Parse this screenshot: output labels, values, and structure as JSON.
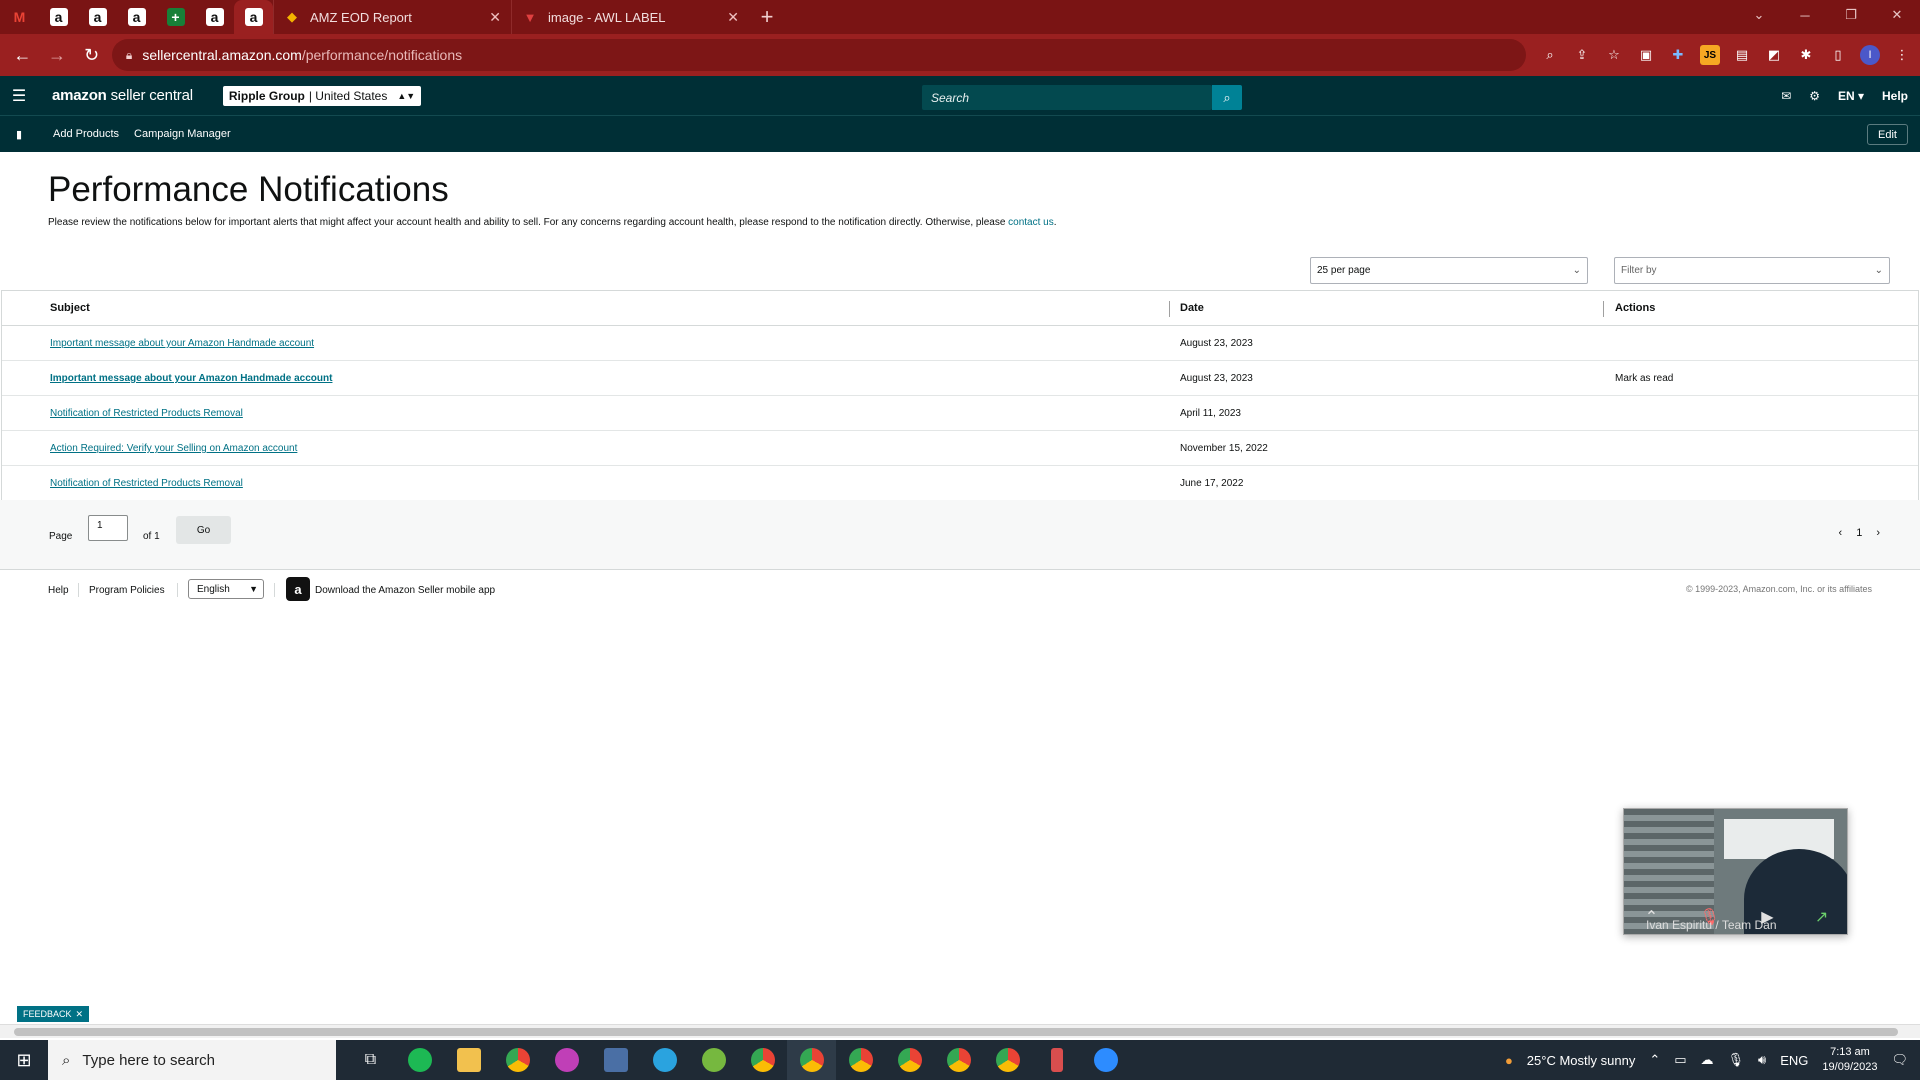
{
  "browser": {
    "tabs": [
      {
        "title": "AMZ EOD Report",
        "icon": "google-sheets-like-icon"
      },
      {
        "title": "image - AWL LABEL",
        "icon": "image-icon"
      }
    ],
    "url_host": "sellercentral.amazon.com",
    "url_path": "/performance/notifications"
  },
  "header": {
    "logo_bold": "amazon",
    "logo_rest": " seller central",
    "account_bold": "Ripple Group",
    "account_rest": " | United States",
    "search_placeholder": "Search",
    "lang": "EN",
    "help": "Help"
  },
  "bookmarks": {
    "items": [
      "Add Products",
      "Campaign Manager"
    ],
    "edit": "Edit"
  },
  "page": {
    "title": "Performance Notifications",
    "description": "Please review the notifications below for important alerts that might affect your account health and ability to sell. For any concerns regarding account health, please respond to the notification directly. Otherwise, please ",
    "contact_link": "contact us",
    "per_page": "25 per page",
    "filter_placeholder": "Filter by"
  },
  "table": {
    "headers": [
      "Subject",
      "Date",
      "Actions"
    ],
    "rows": [
      {
        "subject": "Important message about your Amazon Handmade account",
        "date": "August 23, 2023",
        "action": "",
        "unread": false
      },
      {
        "subject": "Important message about your Amazon Handmade account",
        "date": "August 23, 2023",
        "action": "Mark as read",
        "unread": true
      },
      {
        "subject": "Notification of Restricted Products Removal",
        "date": "April 11, 2023",
        "action": "",
        "unread": false
      },
      {
        "subject": "Action Required: Verify your Selling on Amazon account",
        "date": "November 15, 2022",
        "action": "",
        "unread": false
      },
      {
        "subject": "Notification of Restricted Products Removal",
        "date": "June 17, 2022",
        "action": "",
        "unread": false
      }
    ]
  },
  "pager": {
    "page_label": "Page",
    "page_value": "1",
    "of_label": "of 1",
    "go": "Go",
    "current": "1"
  },
  "footer": {
    "help": "Help",
    "policies": "Program Policies",
    "language": "English",
    "app_text": "Download the Amazon Seller mobile app",
    "copyright": "© 1999-2023, Amazon.com, Inc. or its affiliates"
  },
  "video": {
    "name": "Ivan Espiritu / Team Dan"
  },
  "feedback": "FEEDBACK",
  "taskbar": {
    "search": "Type here to search",
    "weather": "25°C  Mostly sunny",
    "lang": "ENG",
    "time": "7:13 am",
    "date": "19/09/2023"
  }
}
